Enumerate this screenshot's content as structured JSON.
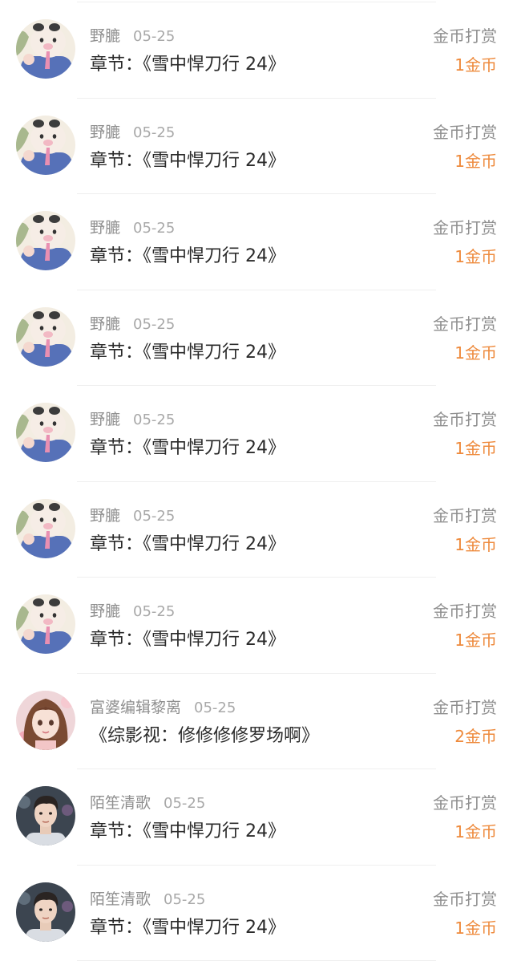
{
  "colors": {
    "amount_orange": "#ee8a3c",
    "muted_gray": "#8f8f8f",
    "text_dark": "#2a2a2a",
    "divider": "#efefef"
  },
  "records": [
    {
      "avatar": "cartoon-piglet-avatar",
      "user": "野膔",
      "date": "05-25",
      "title": "章节：《雪中悍刀行 24》",
      "type": "金币打赏",
      "amount": "1金币"
    },
    {
      "avatar": "cartoon-piglet-avatar",
      "user": "野膔",
      "date": "05-25",
      "title": "章节：《雪中悍刀行 24》",
      "type": "金币打赏",
      "amount": "1金币"
    },
    {
      "avatar": "cartoon-piglet-avatar",
      "user": "野膔",
      "date": "05-25",
      "title": "章节：《雪中悍刀行 24》",
      "type": "金币打赏",
      "amount": "1金币"
    },
    {
      "avatar": "cartoon-piglet-avatar",
      "user": "野膔",
      "date": "05-25",
      "title": "章节：《雪中悍刀行 24》",
      "type": "金币打赏",
      "amount": "1金币"
    },
    {
      "avatar": "cartoon-piglet-avatar",
      "user": "野膔",
      "date": "05-25",
      "title": "章节：《雪中悍刀行 24》",
      "type": "金币打赏",
      "amount": "1金币"
    },
    {
      "avatar": "cartoon-piglet-avatar",
      "user": "野膔",
      "date": "05-25",
      "title": "章节：《雪中悍刀行 24》",
      "type": "金币打赏",
      "amount": "1金币"
    },
    {
      "avatar": "cartoon-piglet-avatar",
      "user": "野膔",
      "date": "05-25",
      "title": "章节：《雪中悍刀行 24》",
      "type": "金币打赏",
      "amount": "1金币"
    },
    {
      "avatar": "anime-girl-avatar",
      "user": "富婆编辑黎离",
      "date": "05-25",
      "title": "《综影视：修修修修罗场啊》",
      "type": "金币打赏",
      "amount": "2金币"
    },
    {
      "avatar": "young-man-photo-avatar",
      "user": "陌笙清歌",
      "date": "05-25",
      "title": "章节：《雪中悍刀行 24》",
      "type": "金币打赏",
      "amount": "1金币"
    },
    {
      "avatar": "young-man-photo-avatar",
      "user": "陌笙清歌",
      "date": "05-25",
      "title": "章节：《雪中悍刀行 24》",
      "type": "金币打赏",
      "amount": "1金币"
    }
  ]
}
